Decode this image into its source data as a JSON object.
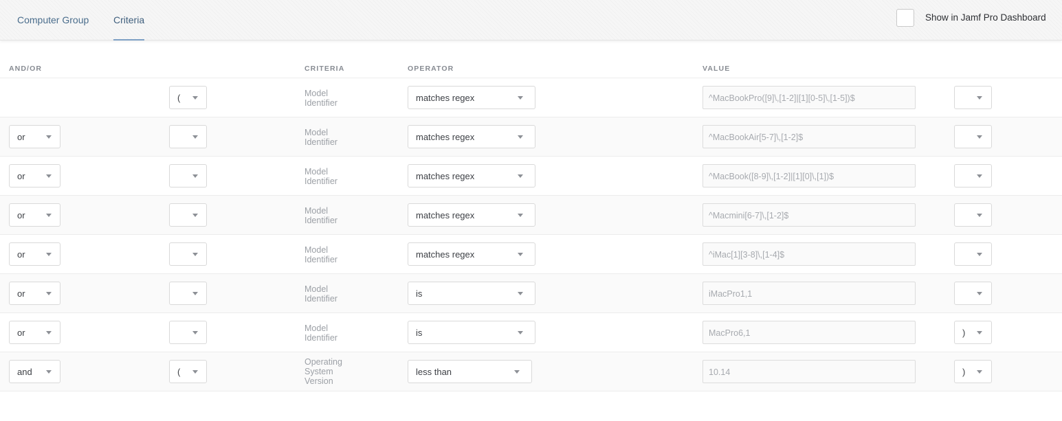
{
  "tabs": [
    {
      "label": "Computer Group",
      "active": false
    },
    {
      "label": "Criteria",
      "active": true
    }
  ],
  "dashboard": {
    "label": "Show in Jamf Pro Dashboard",
    "checked": false
  },
  "columns": {
    "andor": "AND/OR",
    "criteria": "CRITERIA",
    "operator": "OPERATOR",
    "value": "VALUE"
  },
  "rows": [
    {
      "andor": "",
      "open": "(",
      "criteria": "Model Identifier",
      "operator": "matches regex",
      "value": "^MacBookPro([9]\\,[1-2]|[1][0-5]\\,[1-5])$",
      "close": ""
    },
    {
      "andor": "or",
      "open": "",
      "criteria": "Model Identifier",
      "operator": "matches regex",
      "value": "^MacBookAir[5-7]\\,[1-2]$",
      "close": ""
    },
    {
      "andor": "or",
      "open": "",
      "criteria": "Model Identifier",
      "operator": "matches regex",
      "value": "^MacBook([8-9]\\,[1-2]|[1][0]\\,[1])$",
      "close": ""
    },
    {
      "andor": "or",
      "open": "",
      "criteria": "Model Identifier",
      "operator": "matches regex",
      "value": "^Macmini[6-7]\\,[1-2]$",
      "close": ""
    },
    {
      "andor": "or",
      "open": "",
      "criteria": "Model Identifier",
      "operator": "matches regex",
      "value": "^iMac[1][3-8]\\,[1-4]$",
      "close": ""
    },
    {
      "andor": "or",
      "open": "",
      "criteria": "Model Identifier",
      "operator": "is",
      "value": "iMacPro1,1",
      "close": ""
    },
    {
      "andor": "or",
      "open": "",
      "criteria": "Model Identifier",
      "operator": "is",
      "value": "MacPro6,1",
      "close": ")"
    },
    {
      "andor": "and",
      "open": "(",
      "criteria": "Operating System Version",
      "operator": "less than",
      "value": "10.14",
      "close": ")"
    }
  ]
}
